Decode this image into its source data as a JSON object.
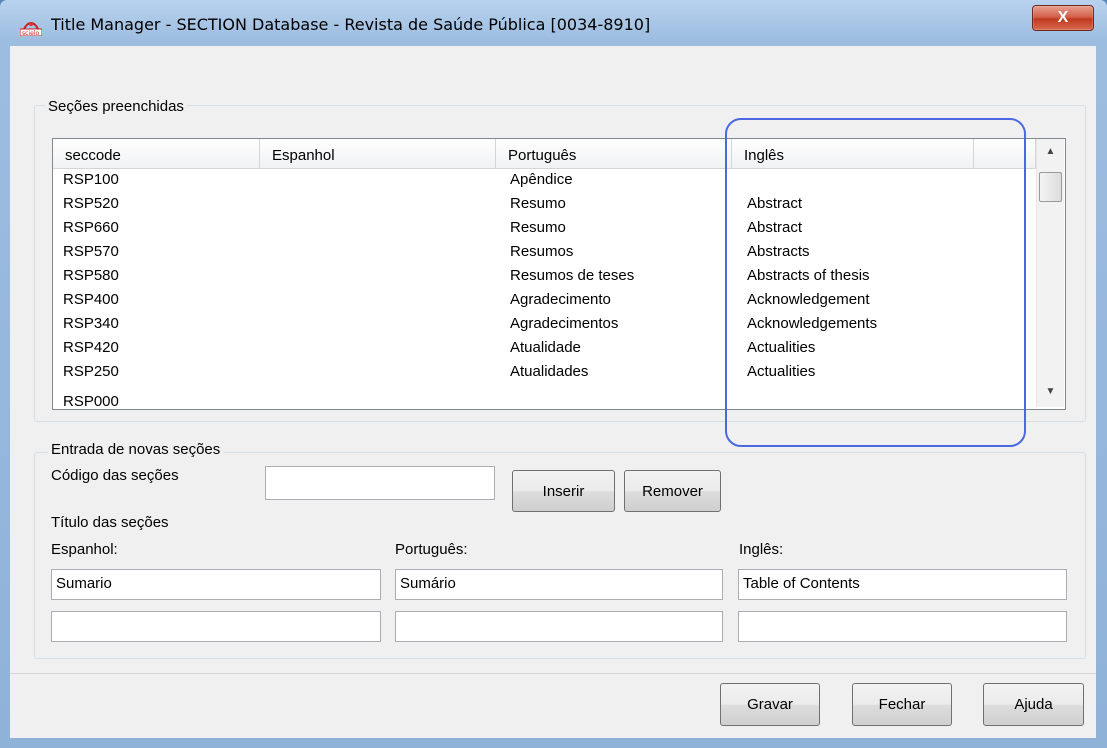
{
  "window": {
    "title": "Title Manager - SECTION Database - Revista de Saúde Pública [0034-8910]",
    "close_label": "X"
  },
  "filled_sections": {
    "group_label": "Seções preenchidas",
    "columns": [
      "seccode",
      "Espanhol",
      "Português",
      "Inglês"
    ],
    "rows": [
      {
        "seccode": "RSP100",
        "es": "",
        "pt": "Apêndice",
        "en": ""
      },
      {
        "seccode": "RSP520",
        "es": "",
        "pt": "Resumo",
        "en": "Abstract"
      },
      {
        "seccode": "RSP660",
        "es": "",
        "pt": "Resumo",
        "en": "Abstract"
      },
      {
        "seccode": "RSP570",
        "es": "",
        "pt": "Resumos",
        "en": "Abstracts"
      },
      {
        "seccode": "RSP580",
        "es": "",
        "pt": "Resumos de teses",
        "en": "Abstracts of thesis"
      },
      {
        "seccode": "RSP400",
        "es": "",
        "pt": "Agradecimento",
        "en": "Acknowledgement"
      },
      {
        "seccode": "RSP340",
        "es": "",
        "pt": "Agradecimentos",
        "en": "Acknowledgements"
      },
      {
        "seccode": "RSP420",
        "es": "",
        "pt": "Atualidade",
        "en": "Actualities"
      },
      {
        "seccode": "RSP250",
        "es": "",
        "pt": "Atualidades",
        "en": "Actualities"
      }
    ],
    "scroll_up_icon": "arrow-up-icon",
    "scroll_down_icon": "arrow-down-icon"
  },
  "new_sections": {
    "group_label": "Entrada de novas seções",
    "code_label": "Código das seções",
    "code_value": "",
    "insert_label": "Inserir",
    "remove_label": "Remover",
    "titles_label": "Título das seções",
    "es_label": "Espanhol:",
    "pt_label": "Português:",
    "en_label": "Inglês:",
    "es_value": "Sumario",
    "pt_value": "Sumário",
    "en_value": "Table of Contents",
    "es_value2": "",
    "pt_value2": "",
    "en_value2": ""
  },
  "footer": {
    "save_label": "Gravar",
    "close_label": "Fechar",
    "help_label": "Ajuda"
  },
  "colors": {
    "highlight": "#4a69e0",
    "close_button": "#c0391f"
  }
}
